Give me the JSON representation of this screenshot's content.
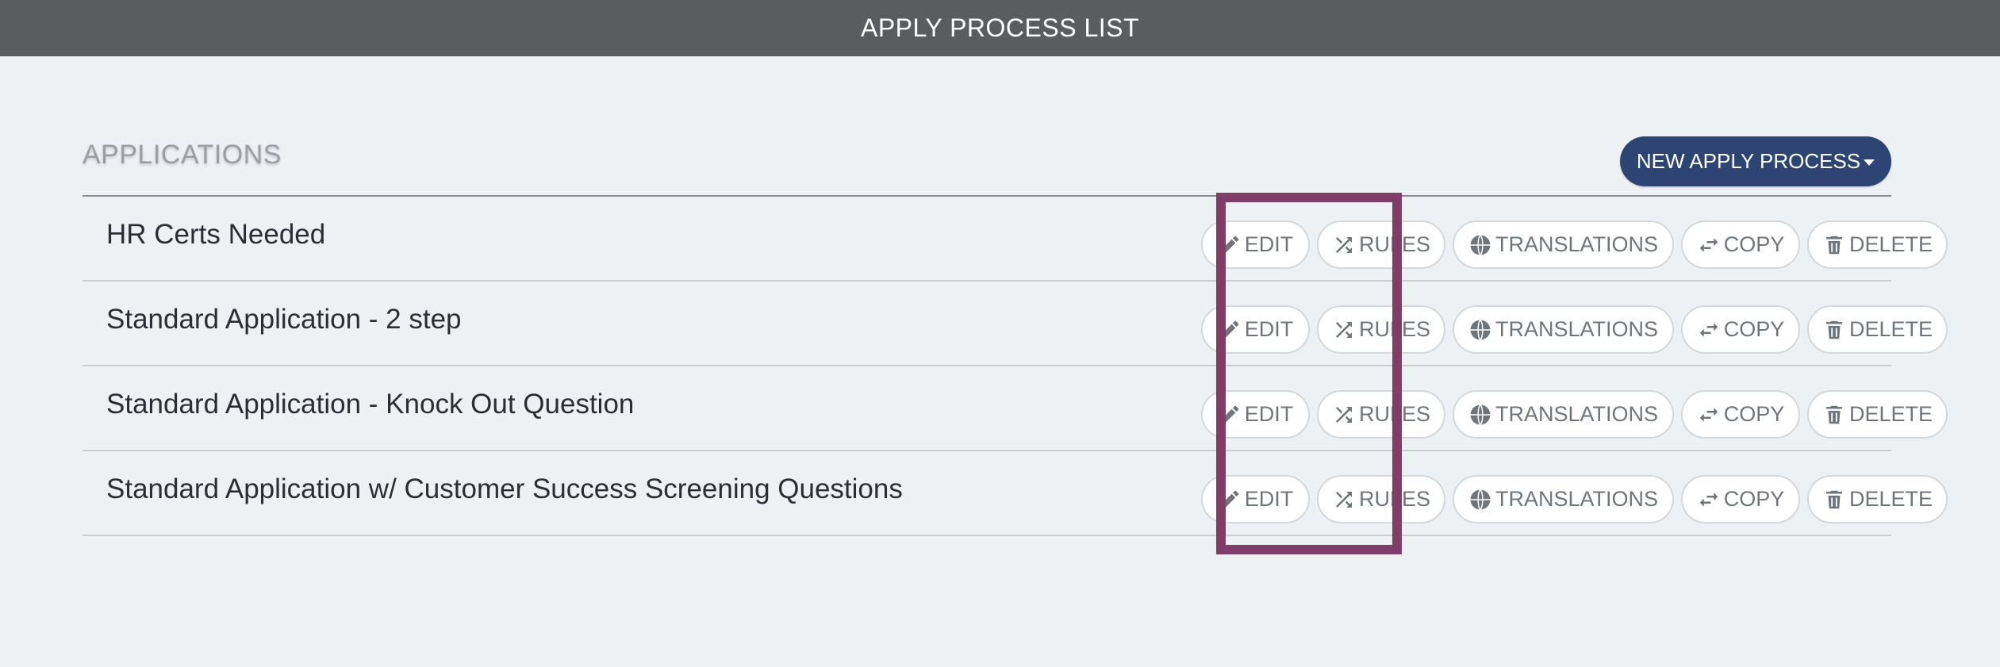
{
  "header": {
    "title": "APPLY PROCESS LIST"
  },
  "section": {
    "title": "APPLICATIONS",
    "new_button_label": "NEW APPLY PROCESS"
  },
  "actions": {
    "edit": "EDIT",
    "rules": "RULES",
    "translations": "TRANSLATIONS",
    "copy": "COPY",
    "delete": "DELETE"
  },
  "rows": [
    {
      "name": "HR Certs Needed"
    },
    {
      "name": "Standard Application - 2 step"
    },
    {
      "name": "Standard Application - Knock Out Question"
    },
    {
      "name": "Standard Application w/ Customer Success Screening Questions"
    }
  ],
  "colors": {
    "topbar": "#5b5c5f",
    "primary_button": "#2e4574",
    "highlight_box": "#7f3d68",
    "background": "#eef1f4"
  },
  "icons": {
    "edit": "pencil-icon",
    "rules": "shuffle-icon",
    "translations": "globe-icon",
    "copy": "swap-arrows-icon",
    "delete": "trash-icon"
  }
}
